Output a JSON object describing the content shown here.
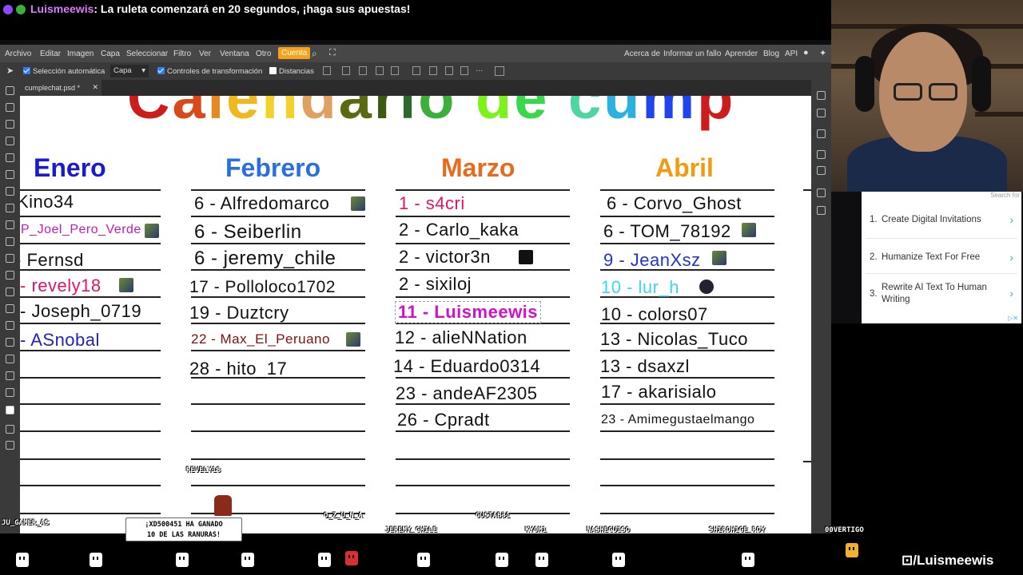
{
  "chat": {
    "username": "Luismeewis",
    "message": ": La ruleta comenzará en 20 segundos, ¡haga sus apuestas!"
  },
  "menubar": {
    "items": [
      "Archivo",
      "Editar",
      "Imagen",
      "Capa",
      "Seleccionar",
      "Filtro",
      "Ver",
      "Ventana",
      "Otro",
      "Cuenta"
    ],
    "right_items": [
      "Acerca de",
      "Informar un fallo",
      "Aprender",
      "Blog",
      "API"
    ]
  },
  "options": {
    "auto_select_label": "Selección automática",
    "layer_select_value": "Capa",
    "transform_controls_label": "Controles de transformación",
    "distances_label": "Distancias"
  },
  "document_tab": {
    "name": "cumplechat.psd *",
    "close": "✕"
  },
  "canvas": {
    "title_fragment": "Calendario de cump",
    "title_colors": [
      "#cc1c1c",
      "#d94a1a",
      "#e8891f",
      "#f0b81d",
      "#f2d22a",
      "#e0a060",
      "#5a6a10",
      "#3a5a10",
      "#2b6a2b",
      "#3ab03a",
      "#7cf21b",
      "#39d84a",
      "#4ed6a0",
      "#2bb0e0",
      "#2244ee"
    ],
    "columns": [
      {
        "month": "Enero",
        "color": "#1a1ad0",
        "entries": [
          {
            "text": "Kino34",
            "color": "#111"
          },
          {
            "text": "P_Joel_Pero_Verde",
            "color": "#c51ab5"
          },
          {
            "text": "- Fernsd",
            "color": "#111"
          },
          {
            "text": "- revely18",
            "color": "#e0146a"
          },
          {
            "text": "- Joseph_0719",
            "color": "#111"
          },
          {
            "text": "- ASnobal",
            "color": "#2222c0"
          }
        ]
      },
      {
        "month": "Febrero",
        "color": "#2a6fe0",
        "entries": [
          {
            "text": "6 - Alfredomarco",
            "color": "#111"
          },
          {
            "text": "6 - Seiberlin",
            "color": "#111"
          },
          {
            "text": "6 - jeremy_chile",
            "color": "#111"
          },
          {
            "text": "17 - Polloloco1702",
            "color": "#111"
          },
          {
            "text": "19 - Duztcry",
            "color": "#111"
          },
          {
            "text": "22 - Max_El_Peruano",
            "color": "#7a1010"
          },
          {
            "text": "28 - hito_17",
            "color": "#111"
          }
        ]
      },
      {
        "month": "Marzo",
        "color": "#e86a1a",
        "entries": [
          {
            "text": "1 - s4cri",
            "color": "#e0146a"
          },
          {
            "text": "2 - Carlo_kaka",
            "color": "#111"
          },
          {
            "text": "2 - victor3n",
            "color": "#111"
          },
          {
            "text": "2 - sixiloj",
            "color": "#111"
          },
          {
            "text": "11 - Luismeewis",
            "color": "#d012c8"
          },
          {
            "text": "12 - alieNNation",
            "color": "#111"
          },
          {
            "text": "14 - Eduardo0314",
            "color": "#111"
          },
          {
            "text": "23 - andeAF2305",
            "color": "#111"
          },
          {
            "text": "26 - Cpradt",
            "color": "#111"
          }
        ]
      },
      {
        "month": "Abril",
        "color": "#f29a10",
        "entries": [
          {
            "text": "6 - Corvo_Ghost",
            "color": "#111"
          },
          {
            "text": "6 - TOM_78192",
            "color": "#111"
          },
          {
            "text": "9 - JeanXsz",
            "color": "#2233cc"
          },
          {
            "text": "10 - lur_h",
            "color": "#3ad8ee"
          },
          {
            "text": "10 - colors07",
            "color": "#111"
          },
          {
            "text": "13 - Nicolas_Tuco",
            "color": "#111"
          },
          {
            "text": "13 - dsaxzl",
            "color": "#111"
          },
          {
            "text": "17 - akarisialo",
            "color": "#111"
          },
          {
            "text": "23 - Amimegustaelmango",
            "color": "#111"
          }
        ]
      }
    ]
  },
  "ad": {
    "search_label": "Search for",
    "items": [
      {
        "num": "1.",
        "text": "Create Digital Invitations"
      },
      {
        "num": "2.",
        "text": "Humanize Text For Free"
      },
      {
        "num": "3.",
        "text": "Rewrite AI Text To Human Writing"
      }
    ]
  },
  "overlay": {
    "names": [
      "REVELY18",
      "JU_GAMER_AS",
      "O_Z_U_N_A",
      "GUSTAB31",
      "JEREMY_CHILE",
      "KY0M1",
      "NASHECUISO",
      "SHIROHIGE_ROY",
      "00VERTIGO"
    ],
    "toast_line1": "¡XD500451 HA GANADO",
    "toast_line2": "10 DE LAS RANURAS!",
    "handle": "⊡/Luismeewis"
  }
}
